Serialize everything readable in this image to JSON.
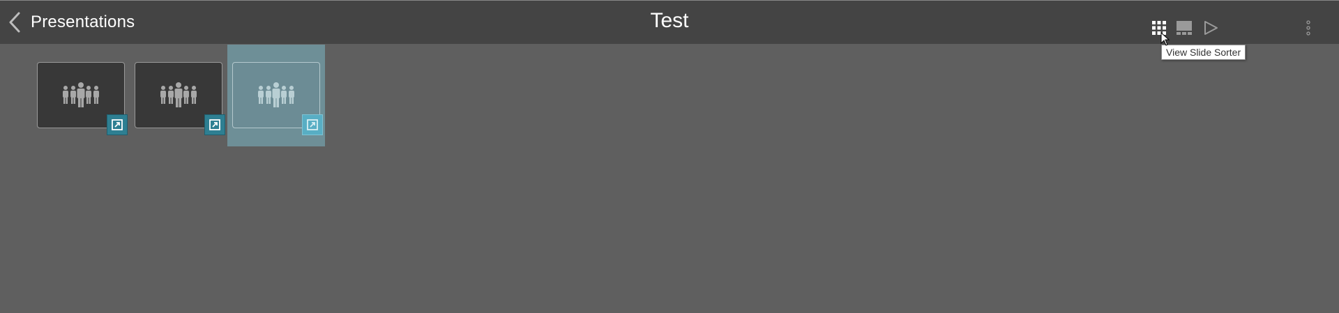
{
  "header": {
    "back_label": "Presentations",
    "title": "Test"
  },
  "toolbar": {
    "icons": [
      "grid-icon",
      "filmstrip-icon",
      "play-icon",
      "more-vertical-icon"
    ],
    "tooltip": "View Slide Sorter"
  },
  "slides": [
    {
      "icon": "people-icon",
      "badge_icon": "link-icon",
      "selected": false
    },
    {
      "icon": "people-icon",
      "badge_icon": "link-icon",
      "selected": false
    },
    {
      "icon": "people-icon",
      "badge_icon": "link-icon",
      "selected": true
    }
  ],
  "colors": {
    "topbar": "#444444",
    "canvas": "#5f5f5f",
    "badge": "#2e7f92",
    "selection": "#6e8f97"
  }
}
